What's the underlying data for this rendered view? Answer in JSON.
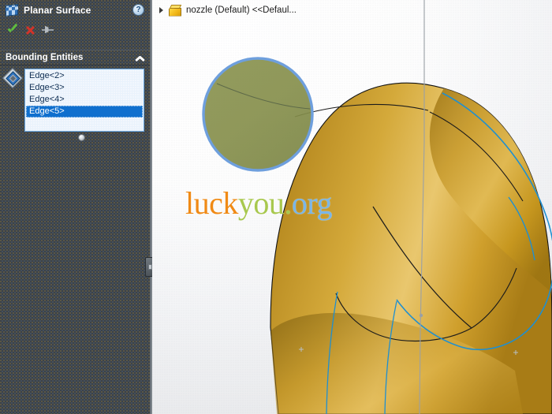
{
  "panel": {
    "title": "Planar Surface",
    "title_icon": "planar-surface-icon",
    "help_glyph": "?",
    "actions": [
      {
        "name": "ok-button",
        "icon": "green-check-icon",
        "tooltip": "OK"
      },
      {
        "name": "cancel-button",
        "icon": "red-x-icon",
        "tooltip": "Cancel"
      },
      {
        "name": "keep-visible-button",
        "icon": "pushpin-icon",
        "tooltip": "Keep Visible"
      }
    ],
    "section": {
      "title": "Bounding Entities",
      "collapse_icon": "chevron-up-icon",
      "selection_icon": "edge-selection-icon",
      "items": [
        {
          "label": "Edge<2>",
          "selected": false
        },
        {
          "label": "Edge<3>",
          "selected": false
        },
        {
          "label": "Edge<4>",
          "selected": false
        },
        {
          "label": "Edge<5>",
          "selected": true
        }
      ]
    },
    "colors": {
      "background": "#3b4249",
      "text": "#ffffff",
      "list_background": "#e9f2fc",
      "list_border": "#6faadf",
      "selection_blue": "#0f6fce",
      "check_green": "#5fbd3f",
      "cancel_red": "#d2342a"
    }
  },
  "viewport": {
    "breadcrumb": {
      "expand_icon": "triangle-right-icon",
      "part_icon": "part-document-icon",
      "text": "nozzle (Default) <<Defaul..."
    },
    "watermark": {
      "part1": "luck",
      "part2": "you.",
      "part3": "org",
      "color1": "#f08a15",
      "color2": "#a8c84e",
      "color3": "#7ab6e8"
    },
    "model": {
      "name": "nozzle-surface-model",
      "surface_color_light": "#e8c268",
      "surface_color_mid": "#c89a2e",
      "surface_color_dark": "#9a7418",
      "preview_face_color": "#87904b",
      "preview_edge_color": "#6e9fdd",
      "sketch_edge_color": "#1f8fd0",
      "hard_edge_color": "#1a1a1a",
      "axis_color": "#9aa0a6"
    },
    "background_color": "#f2f3f5"
  }
}
